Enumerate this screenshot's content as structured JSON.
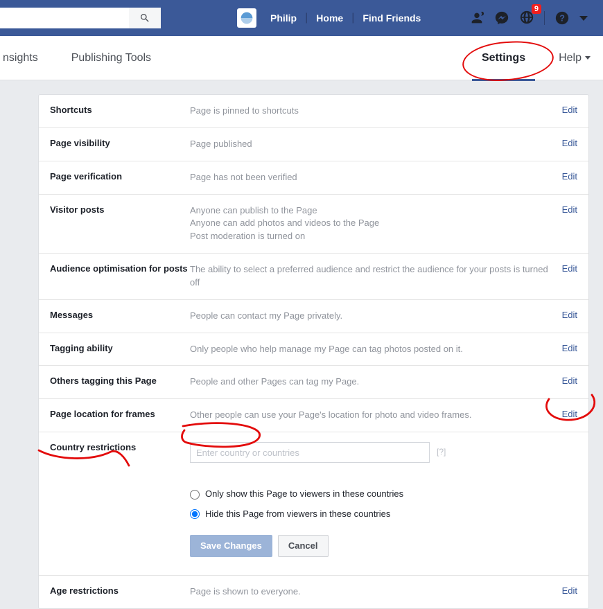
{
  "topbar": {
    "user_name": "Philip",
    "home": "Home",
    "find_friends": "Find Friends",
    "search_placeholder": "",
    "notif_count": "9"
  },
  "tabs": {
    "insights": "nsights",
    "publishing": "Publishing Tools",
    "settings": "Settings",
    "help": "Help"
  },
  "settings_rows": {
    "shortcuts": {
      "label": "Shortcuts",
      "desc": "Page is pinned to shortcuts",
      "edit": "Edit"
    },
    "visibility": {
      "label": "Page visibility",
      "desc": "Page published",
      "edit": "Edit"
    },
    "verification": {
      "label": "Page verification",
      "desc": "Page has not been verified",
      "edit": "Edit"
    },
    "visitor_posts": {
      "label": "Visitor posts",
      "line1": "Anyone can publish to the Page",
      "line2": "Anyone can add photos and videos to the Page",
      "line3": "Post moderation is turned on",
      "edit": "Edit"
    },
    "audience": {
      "label": "Audience optimisation for posts",
      "desc": "The ability to select a preferred audience and restrict the audience for your posts is turned off",
      "edit": "Edit"
    },
    "messages": {
      "label": "Messages",
      "desc": "People can contact my Page privately.",
      "edit": "Edit"
    },
    "tagging": {
      "label": "Tagging ability",
      "desc": "Only people who help manage my Page can tag photos posted on it.",
      "edit": "Edit"
    },
    "others_tagging": {
      "label": "Others tagging this Page",
      "desc": "People and other Pages can tag my Page.",
      "edit": "Edit"
    },
    "location_frames": {
      "label": "Page location for frames",
      "desc": "Other people can use your Page's location for photo and video frames.",
      "edit": "Edit"
    },
    "country": {
      "label": "Country restrictions",
      "placeholder": "Enter country or countries",
      "help": "[?]",
      "opt_show": "Only show this Page to viewers in these countries",
      "opt_hide": "Hide this Page from viewers in these countries",
      "save": "Save Changes",
      "cancel": "Cancel"
    },
    "age": {
      "label": "Age restrictions",
      "desc": "Page is shown to everyone.",
      "edit": "Edit"
    }
  }
}
